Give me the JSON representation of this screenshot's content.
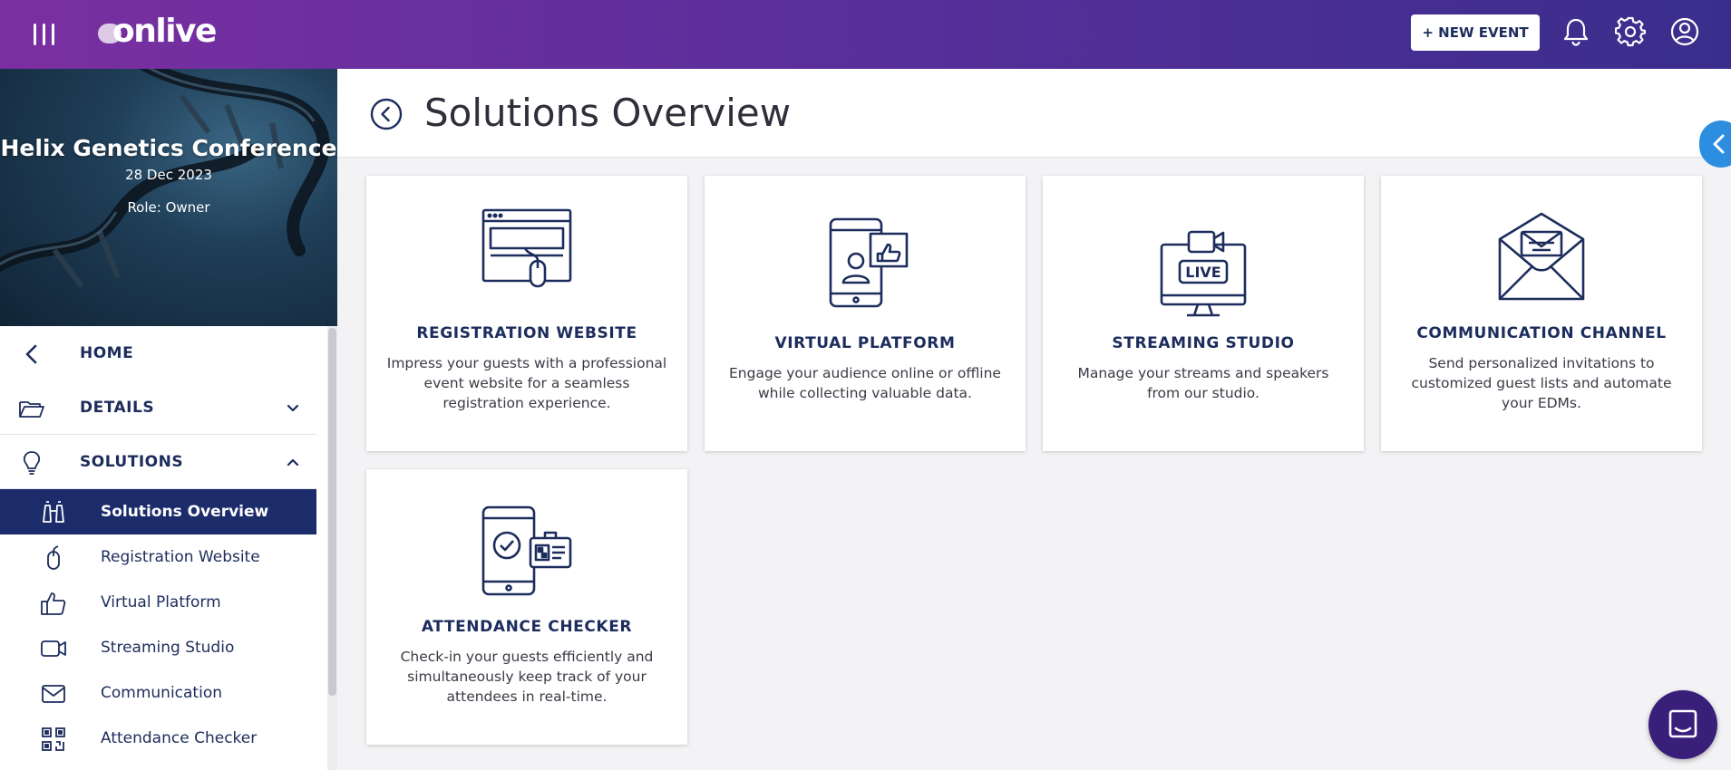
{
  "header": {
    "logo": "onlive",
    "new_event_label": "+ NEW EVENT"
  },
  "event": {
    "title": "Helix Genetics Conference",
    "date": "28 Dec 2023",
    "role": "Role: Owner"
  },
  "nav": {
    "home": "HOME",
    "details": "DETAILS",
    "solutions": "SOLUTIONS",
    "items": [
      {
        "label": "Solutions Overview",
        "icon": "binoculars-icon",
        "active": true
      },
      {
        "label": "Registration Website",
        "icon": "mouse-icon"
      },
      {
        "label": "Virtual Platform",
        "icon": "thumbs-up-icon"
      },
      {
        "label": "Streaming Studio",
        "icon": "video-camera-icon"
      },
      {
        "label": "Communication",
        "icon": "envelope-icon"
      },
      {
        "label": "Attendance Checker",
        "icon": "qr-code-icon"
      }
    ]
  },
  "main": {
    "title": "Solutions Overview",
    "cards": [
      {
        "title": "REGISTRATION WEBSITE",
        "desc": "Impress your guests with a professional event website for a seamless registration experience.",
        "icon": "website-mouse-icon"
      },
      {
        "title": "VIRTUAL PLATFORM",
        "desc": "Engage your audience online or offline while collecting valuable data.",
        "icon": "phone-like-icon"
      },
      {
        "title": "STREAMING STUDIO",
        "desc": "Manage your streams and speakers from our studio.",
        "icon": "live-monitor-icon"
      },
      {
        "title": "COMMUNICATION CHANNEL",
        "desc": "Send personalized invitations to customized guest lists and automate your EDMs.",
        "icon": "open-envelope-icon"
      },
      {
        "title": "ATTENDANCE CHECKER",
        "desc": "Check-in your guests efficiently and simultaneously keep track of your attendees in real-time.",
        "icon": "phone-check-badge-icon"
      }
    ]
  },
  "colors": {
    "navy": "#1c2c5c",
    "active_bg": "#1c2c6a",
    "header_start": "#7b2fa0",
    "header_end": "#3a2e8c",
    "side_tab": "#2d8ee0",
    "chat": "#3a1f7a"
  }
}
